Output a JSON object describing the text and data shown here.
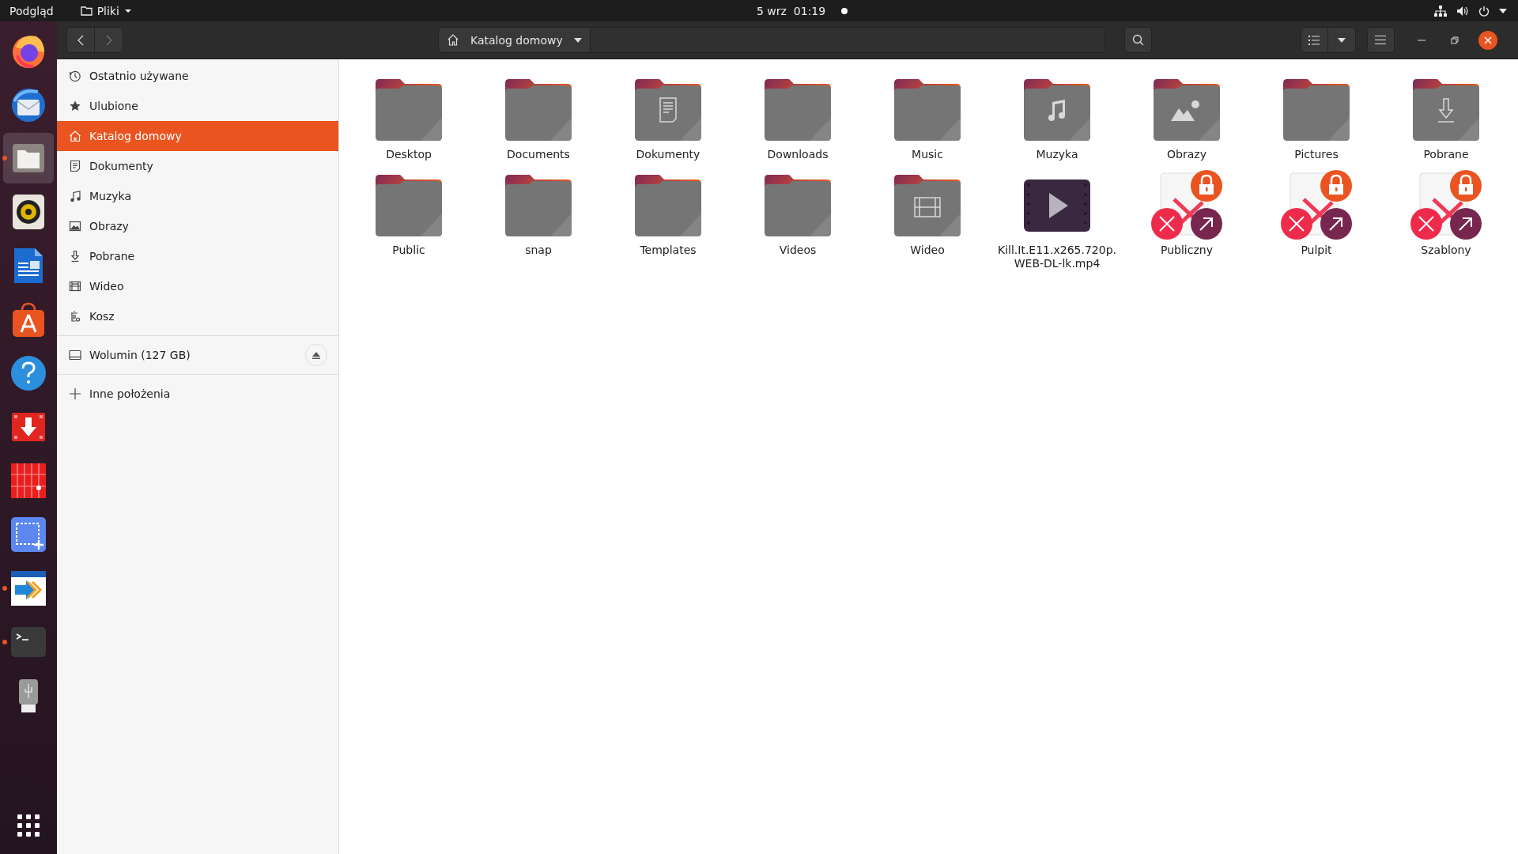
{
  "top_bar": {
    "activities": "Podgląd",
    "app_menu": "Pliki",
    "clock": "5 wrz  01:19",
    "notification_dot": true
  },
  "dock": [
    {
      "kind": "firefox",
      "running": false,
      "selected": false
    },
    {
      "kind": "mail",
      "running": false,
      "selected": false
    },
    {
      "kind": "files",
      "running": true,
      "selected": true
    },
    {
      "kind": "speaker",
      "running": false,
      "selected": false
    },
    {
      "kind": "writer",
      "running": false,
      "selected": false
    },
    {
      "kind": "store",
      "running": false,
      "selected": false
    },
    {
      "kind": "help",
      "running": false,
      "selected": false
    },
    {
      "kind": "download",
      "running": false,
      "selected": false
    },
    {
      "kind": "grid",
      "running": false,
      "selected": false
    },
    {
      "kind": "screenshot",
      "running": false,
      "selected": false
    },
    {
      "kind": "arrows",
      "running": true,
      "selected": false
    },
    {
      "kind": "terminal",
      "running": true,
      "selected": false
    },
    {
      "kind": "usb",
      "running": false,
      "selected": false
    }
  ],
  "header": {
    "back_disabled": false,
    "forward_disabled": true,
    "path": "Katalog domowy"
  },
  "sidebar": {
    "places": [
      {
        "kind": "clock",
        "label": "Ostatnio używane",
        "selected": false
      },
      {
        "kind": "star",
        "label": "Ulubione",
        "selected": false
      },
      {
        "kind": "home",
        "label": "Katalog domowy",
        "selected": true
      },
      {
        "kind": "document",
        "label": "Dokumenty",
        "selected": false
      },
      {
        "kind": "music",
        "label": "Muzyka",
        "selected": false
      },
      {
        "kind": "picture",
        "label": "Obrazy",
        "selected": false
      },
      {
        "kind": "download",
        "label": "Pobrane",
        "selected": false
      },
      {
        "kind": "film",
        "label": "Wideo",
        "selected": false
      },
      {
        "kind": "trash",
        "label": "Kosz",
        "selected": false
      }
    ],
    "volume": {
      "label": "Wolumin (127 GB)"
    },
    "other": {
      "label": "Inne położenia"
    }
  },
  "files": [
    {
      "kind": "folder",
      "label": "Desktop"
    },
    {
      "kind": "folder",
      "label": "Documents"
    },
    {
      "kind": "folder-documents",
      "label": "Dokumenty"
    },
    {
      "kind": "folder",
      "label": "Downloads"
    },
    {
      "kind": "folder",
      "label": "Music"
    },
    {
      "kind": "folder-music",
      "label": "Muzyka"
    },
    {
      "kind": "folder-pictures",
      "label": "Obrazy"
    },
    {
      "kind": "folder",
      "label": "Pictures"
    },
    {
      "kind": "folder-download",
      "label": "Pobrane"
    },
    {
      "kind": "folder",
      "label": "Public"
    },
    {
      "kind": "folder",
      "label": "snap"
    },
    {
      "kind": "folder",
      "label": "Templates"
    },
    {
      "kind": "folder",
      "label": "Videos"
    },
    {
      "kind": "folder-video",
      "label": "Wideo"
    },
    {
      "kind": "video",
      "label": "Kill.It.E11.x265.720p.\nWEB-DL-lk.mp4"
    },
    {
      "kind": "broken-link",
      "label": "Publiczny"
    },
    {
      "kind": "broken-link",
      "label": "Pulpit"
    },
    {
      "kind": "broken-link",
      "label": "Szablony"
    }
  ]
}
